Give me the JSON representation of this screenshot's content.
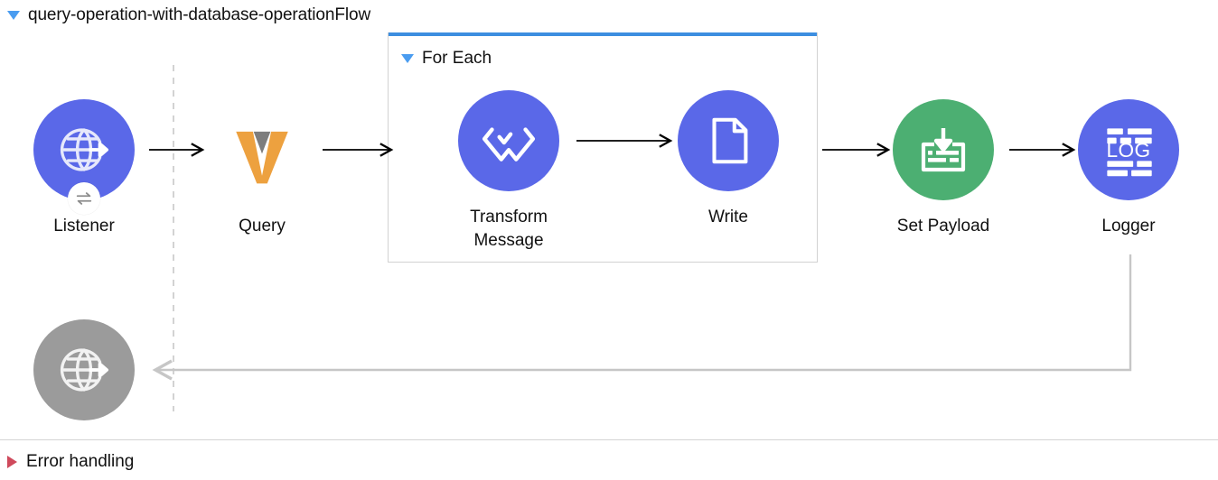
{
  "flow": {
    "title": "query-operation-with-database-operationFlow",
    "disclosure_icon": "triangle-down-icon",
    "expanded": true
  },
  "scope": {
    "title": "For Each",
    "disclosure_icon": "triangle-down-icon",
    "expanded": true,
    "accent_color": "#3c8ee0",
    "border_color": "#d2d2d2"
  },
  "footer": {
    "label": "Error handling",
    "disclosure_icon": "triangle-right-icon",
    "expanded": false,
    "marker_color": "#cf4a5c"
  },
  "colors": {
    "mule_blue": "#5a68e8",
    "mule_green": "#4caf72",
    "disabled_gray": "#9b9b9b",
    "query_orange": "#eda13f",
    "query_gray": "#7d7d7d",
    "connector_black": "#000000",
    "connector_gray": "#c6c6c6",
    "canvas_white": "#ffffff"
  },
  "nodes": [
    {
      "id": "listener",
      "label": "Listener",
      "icon": "http-listener-globe-icon",
      "badge_icon": "exchange-arrows-icon",
      "shape": "circle",
      "fill": "#5a68e8"
    },
    {
      "id": "query",
      "label": "Query",
      "icon": "database-query-v-icon",
      "shape": "none",
      "fill": "transparent"
    },
    {
      "id": "transform-message",
      "label": "Transform\nMessage",
      "icon": "dataweave-transform-icon",
      "shape": "circle",
      "fill": "#5a68e8"
    },
    {
      "id": "write",
      "label": "Write",
      "icon": "file-document-icon",
      "shape": "circle",
      "fill": "#5a68e8"
    },
    {
      "id": "set-payload",
      "label": "Set Payload",
      "icon": "set-payload-arrow-into-box-icon",
      "shape": "circle",
      "fill": "#4caf72"
    },
    {
      "id": "logger",
      "label": "Logger",
      "icon": "logger-log-icon",
      "shape": "circle",
      "fill": "#5a68e8"
    },
    {
      "id": "response",
      "label": "",
      "icon": "http-response-globe-icon",
      "shape": "circle",
      "fill": "#9b9b9b"
    }
  ],
  "connectors": [
    {
      "id": "listener-to-query",
      "style": "solid-black-arrow"
    },
    {
      "id": "query-to-foreach",
      "style": "solid-black-arrow"
    },
    {
      "id": "transform-to-write",
      "style": "solid-black-arrow"
    },
    {
      "id": "foreach-to-setpayload",
      "style": "solid-black-arrow"
    },
    {
      "id": "setpayload-to-logger",
      "style": "solid-black-arrow"
    },
    {
      "id": "logger-to-response",
      "style": "gray-return-path"
    },
    {
      "id": "source-boundary",
      "style": "gray-dashed-vertical"
    }
  ]
}
